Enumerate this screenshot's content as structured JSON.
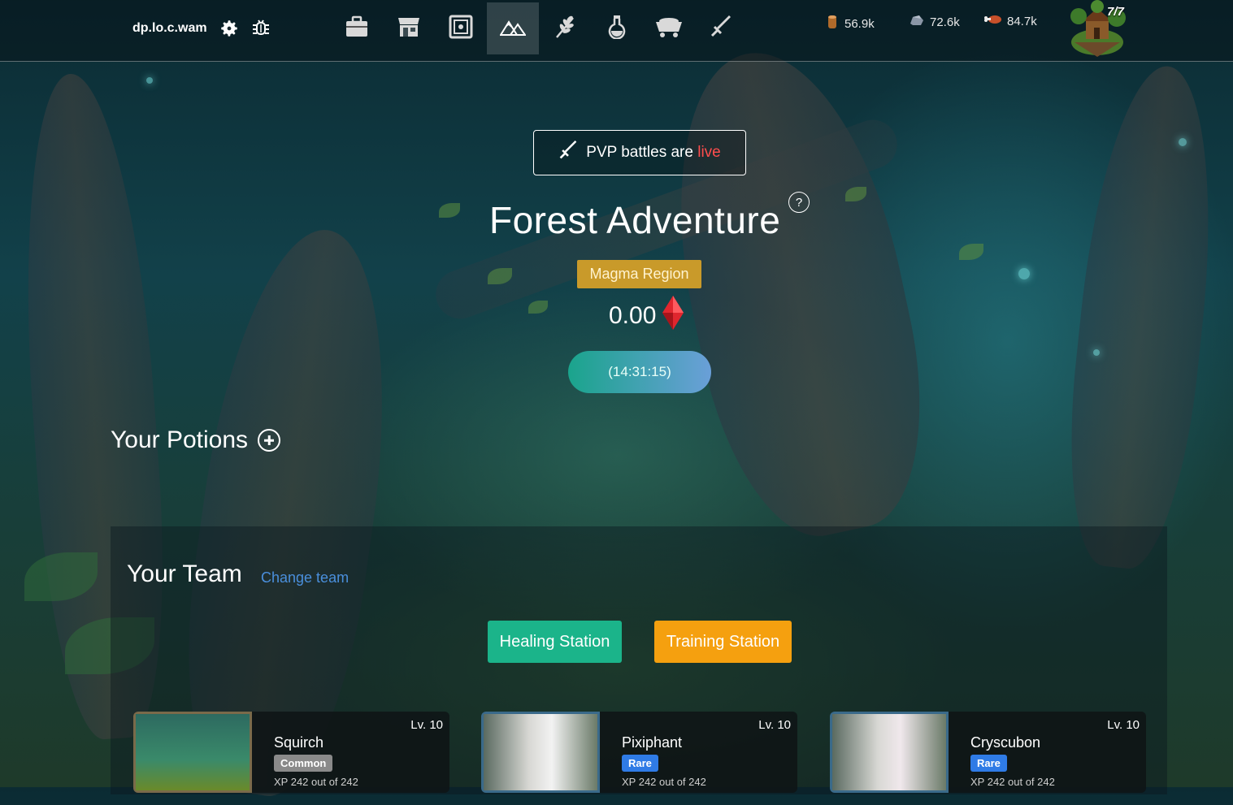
{
  "topbar": {
    "account": "dp.lo.c.wam",
    "icons": [
      "gear-icon",
      "bug-icon"
    ],
    "nav": [
      {
        "name": "inventory",
        "icon": "briefcase-icon",
        "active": false
      },
      {
        "name": "market",
        "icon": "shop-icon",
        "active": false
      },
      {
        "name": "vault",
        "icon": "safe-icon",
        "active": false
      },
      {
        "name": "adventure",
        "icon": "mountains-icon",
        "active": true
      },
      {
        "name": "farm",
        "icon": "wheat-icon",
        "active": false
      },
      {
        "name": "potions",
        "icon": "flask-icon",
        "active": false
      },
      {
        "name": "mining",
        "icon": "minecart-icon",
        "active": false
      },
      {
        "name": "battle",
        "icon": "sword-icon",
        "active": false
      }
    ],
    "resources": [
      {
        "name": "wood",
        "value": "56.9k"
      },
      {
        "name": "stone",
        "value": "72.6k"
      },
      {
        "name": "meat",
        "value": "84.7k"
      }
    ],
    "village_count": "7/7"
  },
  "pvp": {
    "prefix": "PVP battles are ",
    "status": "live"
  },
  "adventure": {
    "title": "Forest Adventure",
    "help": "?",
    "region": "Magma Region",
    "gems": "0.00",
    "timer": "(14:31:15)"
  },
  "potions": {
    "heading": "Your Potions"
  },
  "team": {
    "heading": "Your Team",
    "change_link": "Change team",
    "heal_label": "Healing Station",
    "train_label": "Training Station",
    "members": [
      {
        "name": "Squirch",
        "level": "Lv. 10",
        "rarity": "Common",
        "xp": "XP 242 out of 242"
      },
      {
        "name": "Pixiphant",
        "level": "Lv. 10",
        "rarity": "Rare",
        "xp": "XP 242 out of 242"
      },
      {
        "name": "Cryscubon",
        "level": "Lv. 10",
        "rarity": "Rare",
        "xp": "XP 242 out of 242"
      }
    ]
  },
  "colors": {
    "region": "#c99a2a",
    "heal": "#1bb48a",
    "train": "#f5a00f",
    "rare": "#2f7be6",
    "common": "#8a8a8a",
    "live": "#ff4d4d",
    "link": "#4a8fdc"
  }
}
